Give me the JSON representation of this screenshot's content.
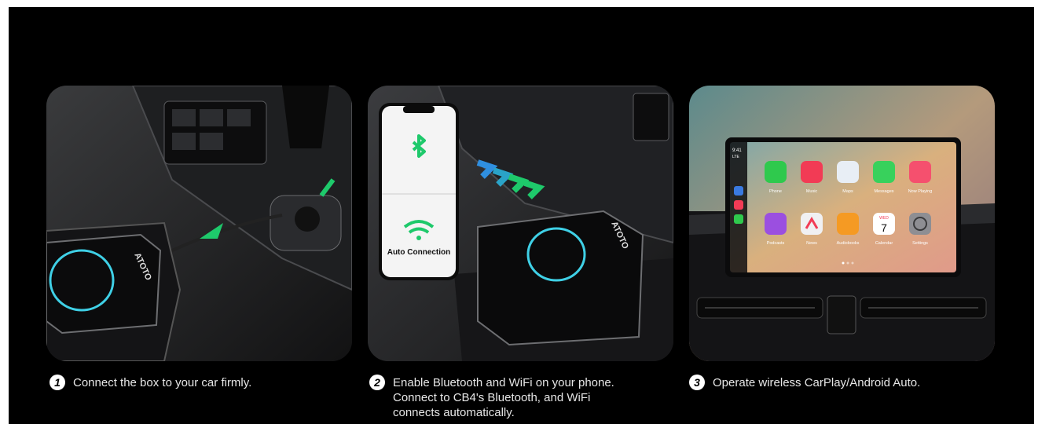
{
  "steps": [
    {
      "number": "1",
      "text": "Connect the box to your car firmly."
    },
    {
      "number": "2",
      "text": "Enable Bluetooth and WiFi on your phone.\nConnect to CB4's Bluetooth, and WiFi\nconnects automatically."
    },
    {
      "number": "3",
      "text": "Operate wireless CarPlay/Android Auto."
    }
  ],
  "device": {
    "brand": "ATOTO"
  },
  "phone": {
    "connection_label": "Auto Connection"
  },
  "carplay": {
    "time": "9:41",
    "signal": "LTE",
    "apps": [
      "Phone",
      "Music",
      "Maps",
      "Messages",
      "Now Playing",
      "Podcasts",
      "News",
      "Audiobooks",
      "Calendar",
      "Settings"
    ],
    "calendar_day": "WED",
    "calendar_date": "7"
  },
  "colors": {
    "accent_ring": "#3fd0e6",
    "arrow_green": "#1ec96b",
    "arrow_blue": "#2f8fe0"
  }
}
